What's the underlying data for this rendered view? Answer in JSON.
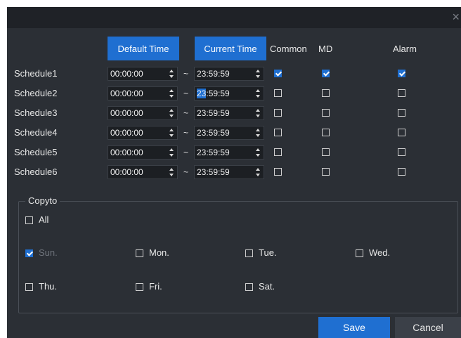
{
  "dialog": {
    "close_glyph": "×"
  },
  "header": {
    "default_time_button": "Default Time",
    "current_time_button": "Current Time",
    "col_common": "Common",
    "col_md": "MD",
    "col_alarm": "Alarm"
  },
  "schedules": [
    {
      "label": "Schedule1",
      "start": "00:00:00",
      "end": "23:59:59",
      "common": true,
      "md": true,
      "alarm": true
    },
    {
      "label": "Schedule2",
      "start": "00:00:00",
      "end_sel": "23",
      "end_rest": ":59:59",
      "end": "23:59:59",
      "common": false,
      "md": false,
      "alarm": false
    },
    {
      "label": "Schedule3",
      "start": "00:00:00",
      "end": "23:59:59",
      "common": false,
      "md": false,
      "alarm": false
    },
    {
      "label": "Schedule4",
      "start": "00:00:00",
      "end": "23:59:59",
      "common": false,
      "md": false,
      "alarm": false
    },
    {
      "label": "Schedule5",
      "start": "00:00:00",
      "end": "23:59:59",
      "common": false,
      "md": false,
      "alarm": false
    },
    {
      "label": "Schedule6",
      "start": "00:00:00",
      "end": "23:59:59",
      "common": false,
      "md": false,
      "alarm": false
    }
  ],
  "separator": "~",
  "copyto": {
    "legend": "Copyto",
    "all": {
      "label": "All",
      "checked": false
    },
    "days": [
      {
        "label": "Sun.",
        "checked": true,
        "disabled": true
      },
      {
        "label": "Mon.",
        "checked": false
      },
      {
        "label": "Tue.",
        "checked": false
      },
      {
        "label": "Wed.",
        "checked": false
      },
      {
        "label": "Thu.",
        "checked": false
      },
      {
        "label": "Fri.",
        "checked": false
      },
      {
        "label": "Sat.",
        "checked": false
      }
    ]
  },
  "footer": {
    "save": "Save",
    "cancel": "Cancel"
  }
}
